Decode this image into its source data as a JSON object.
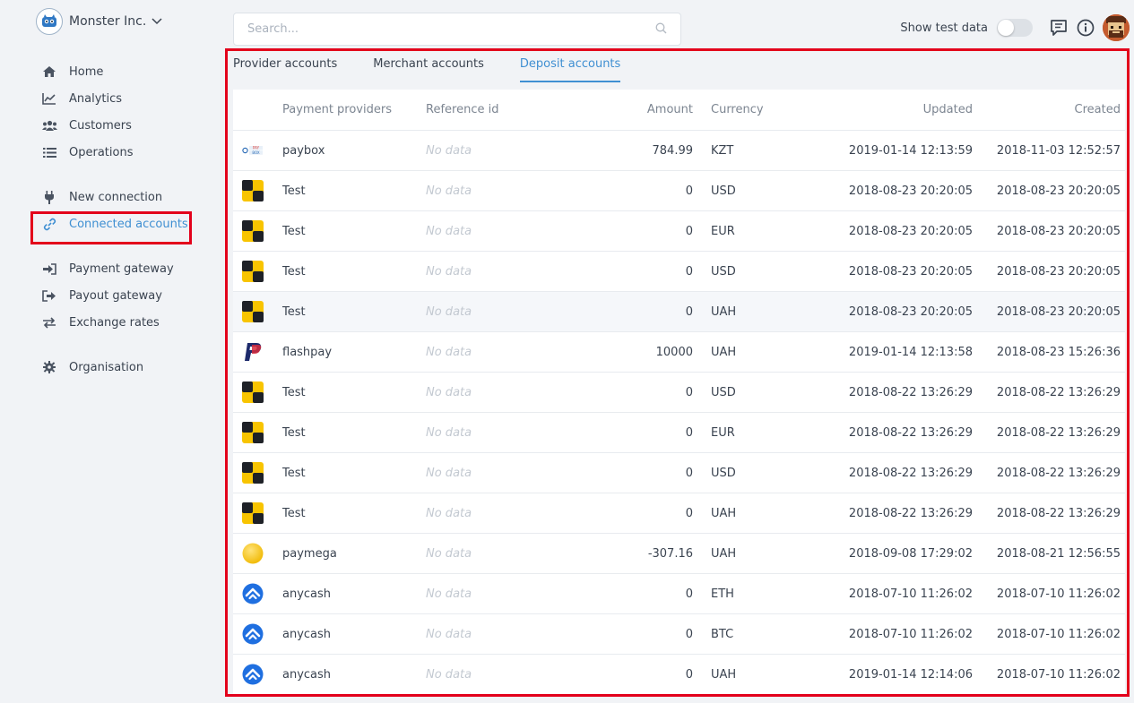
{
  "org": {
    "name": "Monster Inc."
  },
  "nav": [
    {
      "label": "Home",
      "icon": "home-icon"
    },
    {
      "label": "Analytics",
      "icon": "chart-line-icon"
    },
    {
      "label": "Customers",
      "icon": "users-icon"
    },
    {
      "label": "Operations",
      "icon": "list-icon"
    },
    {
      "label": "New connection",
      "icon": "plug-icon"
    },
    {
      "label": "Connected accounts",
      "icon": "link-icon"
    },
    {
      "label": "Payment gateway",
      "icon": "sign-in-icon"
    },
    {
      "label": "Payout gateway",
      "icon": "sign-out-icon"
    },
    {
      "label": "Exchange rates",
      "icon": "exchange-icon"
    },
    {
      "label": "Organisation",
      "icon": "gear-icon"
    }
  ],
  "search": {
    "placeholder": "Search..."
  },
  "topbar": {
    "show_test_label": "Show test data",
    "show_test_enabled": false
  },
  "tabs": [
    {
      "label": "Provider accounts",
      "active": false
    },
    {
      "label": "Merchant accounts",
      "active": false
    },
    {
      "label": "Deposit accounts",
      "active": true
    }
  ],
  "table": {
    "headers": {
      "provider": "Payment providers",
      "reference": "Reference id",
      "amount": "Amount",
      "currency": "Currency",
      "updated": "Updated",
      "created": "Created"
    },
    "rows": [
      {
        "logo": "paybox",
        "provider": "paybox",
        "reference": "No data",
        "amount": "784.99",
        "currency": "KZT",
        "updated": "2019-01-14 12:13:59",
        "created": "2018-11-03 12:52:57"
      },
      {
        "logo": "test",
        "provider": "Test",
        "reference": "No data",
        "amount": "0",
        "currency": "USD",
        "updated": "2018-08-23 20:20:05",
        "created": "2018-08-23 20:20:05"
      },
      {
        "logo": "test",
        "provider": "Test",
        "reference": "No data",
        "amount": "0",
        "currency": "EUR",
        "updated": "2018-08-23 20:20:05",
        "created": "2018-08-23 20:20:05"
      },
      {
        "logo": "test",
        "provider": "Test",
        "reference": "No data",
        "amount": "0",
        "currency": "USD",
        "updated": "2018-08-23 20:20:05",
        "created": "2018-08-23 20:20:05"
      },
      {
        "logo": "test",
        "provider": "Test",
        "reference": "No data",
        "amount": "0",
        "currency": "UAH",
        "updated": "2018-08-23 20:20:05",
        "created": "2018-08-23 20:20:05"
      },
      {
        "logo": "flashpay",
        "provider": "flashpay",
        "reference": "No data",
        "amount": "10000",
        "currency": "UAH",
        "updated": "2019-01-14 12:13:58",
        "created": "2018-08-23 15:26:36"
      },
      {
        "logo": "test",
        "provider": "Test",
        "reference": "No data",
        "amount": "0",
        "currency": "USD",
        "updated": "2018-08-22 13:26:29",
        "created": "2018-08-22 13:26:29"
      },
      {
        "logo": "test",
        "provider": "Test",
        "reference": "No data",
        "amount": "0",
        "currency": "EUR",
        "updated": "2018-08-22 13:26:29",
        "created": "2018-08-22 13:26:29"
      },
      {
        "logo": "test",
        "provider": "Test",
        "reference": "No data",
        "amount": "0",
        "currency": "USD",
        "updated": "2018-08-22 13:26:29",
        "created": "2018-08-22 13:26:29"
      },
      {
        "logo": "test",
        "provider": "Test",
        "reference": "No data",
        "amount": "0",
        "currency": "UAH",
        "updated": "2018-08-22 13:26:29",
        "created": "2018-08-22 13:26:29"
      },
      {
        "logo": "paymega",
        "provider": "paymega",
        "reference": "No data",
        "amount": "-307.16",
        "currency": "UAH",
        "updated": "2018-09-08 17:29:02",
        "created": "2018-08-21 12:56:55"
      },
      {
        "logo": "anycash",
        "provider": "anycash",
        "reference": "No data",
        "amount": "0",
        "currency": "ETH",
        "updated": "2018-07-10 11:26:02",
        "created": "2018-07-10 11:26:02"
      },
      {
        "logo": "anycash",
        "provider": "anycash",
        "reference": "No data",
        "amount": "0",
        "currency": "BTC",
        "updated": "2018-07-10 11:26:02",
        "created": "2018-07-10 11:26:02"
      },
      {
        "logo": "anycash",
        "provider": "anycash",
        "reference": "No data",
        "amount": "0",
        "currency": "UAH",
        "updated": "2019-01-14 12:14:06",
        "created": "2018-07-10 11:26:02"
      }
    ]
  },
  "colors": {
    "accent": "#3f8fd2",
    "highlight": "#e3001b",
    "text": "#3a4350",
    "muted": "#7c8591"
  }
}
